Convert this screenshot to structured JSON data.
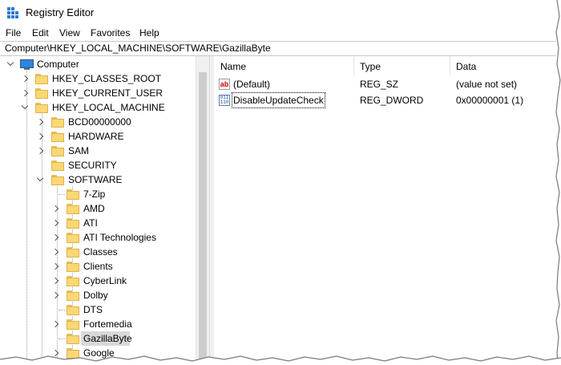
{
  "window": {
    "title": "Registry Editor"
  },
  "menu": [
    "File",
    "Edit",
    "View",
    "Favorites",
    "Help"
  ],
  "address": "Computer\\HKEY_LOCAL_MACHINE\\SOFTWARE\\GazillaByte",
  "tree": {
    "root": "Computer",
    "hives": [
      "HKEY_CLASSES_ROOT",
      "HKEY_CURRENT_USER",
      "HKEY_LOCAL_MACHINE"
    ],
    "hklm_children": [
      "BCD00000000",
      "HARDWARE",
      "SAM",
      "SECURITY",
      "SOFTWARE"
    ],
    "software_children": [
      "7-Zip",
      "AMD",
      "ATI",
      "ATI Technologies",
      "Classes",
      "Clients",
      "CyberLink",
      "Dolby",
      "DTS",
      "Fortemedia",
      "GazillaByte",
      "Google"
    ],
    "selected": "GazillaByte"
  },
  "list": {
    "headers": {
      "name": "Name",
      "type": "Type",
      "data": "Data"
    },
    "rows": [
      {
        "icon": "string-value-icon",
        "name": "(Default)",
        "type": "REG_SZ",
        "data": "(value not set)"
      },
      {
        "icon": "binary-value-icon",
        "name": "DisableUpdateCheck",
        "type": "REG_DWORD",
        "data": "0x00000001 (1)"
      }
    ]
  },
  "colors": {
    "folder": "#fbd874",
    "selection": "#d9d9d9"
  }
}
